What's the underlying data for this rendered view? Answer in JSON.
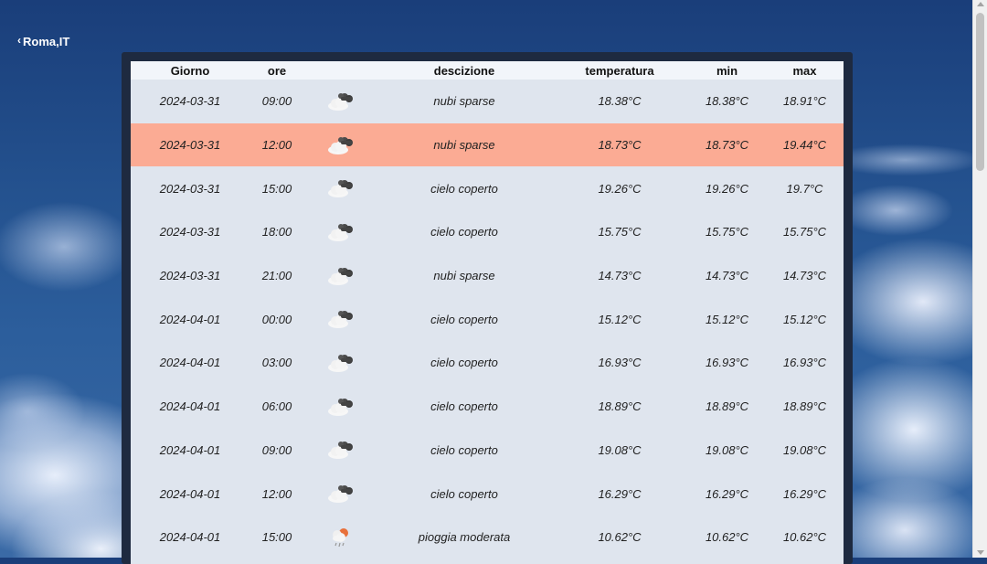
{
  "location": {
    "back_icon": "chevron-left-icon",
    "label": "Roma,IT"
  },
  "table": {
    "headers": {
      "day": "Giorno",
      "hour": "ore",
      "icon": "",
      "desc": "descizione",
      "temp": "temperatura",
      "min": "min",
      "max": "max"
    },
    "rows": [
      {
        "day": "2024-03-31",
        "hour": "09:00",
        "icon": "broken-clouds-icon",
        "desc": "nubi sparse",
        "temp": "18.38°C",
        "min": "18.38°C",
        "max": "18.91°C",
        "highlight": false
      },
      {
        "day": "2024-03-31",
        "hour": "12:00",
        "icon": "broken-clouds-icon",
        "desc": "nubi sparse",
        "temp": "18.73°C",
        "min": "18.73°C",
        "max": "19.44°C",
        "highlight": true
      },
      {
        "day": "2024-03-31",
        "hour": "15:00",
        "icon": "broken-clouds-icon",
        "desc": "cielo coperto",
        "temp": "19.26°C",
        "min": "19.26°C",
        "max": "19.7°C",
        "highlight": false
      },
      {
        "day": "2024-03-31",
        "hour": "18:00",
        "icon": "broken-clouds-icon",
        "desc": "cielo coperto",
        "temp": "15.75°C",
        "min": "15.75°C",
        "max": "15.75°C",
        "highlight": false
      },
      {
        "day": "2024-03-31",
        "hour": "21:00",
        "icon": "broken-clouds-icon",
        "desc": "nubi sparse",
        "temp": "14.73°C",
        "min": "14.73°C",
        "max": "14.73°C",
        "highlight": false
      },
      {
        "day": "2024-04-01",
        "hour": "00:00",
        "icon": "broken-clouds-icon",
        "desc": "cielo coperto",
        "temp": "15.12°C",
        "min": "15.12°C",
        "max": "15.12°C",
        "highlight": false
      },
      {
        "day": "2024-04-01",
        "hour": "03:00",
        "icon": "broken-clouds-icon",
        "desc": "cielo coperto",
        "temp": "16.93°C",
        "min": "16.93°C",
        "max": "16.93°C",
        "highlight": false
      },
      {
        "day": "2024-04-01",
        "hour": "06:00",
        "icon": "broken-clouds-icon",
        "desc": "cielo coperto",
        "temp": "18.89°C",
        "min": "18.89°C",
        "max": "18.89°C",
        "highlight": false
      },
      {
        "day": "2024-04-01",
        "hour": "09:00",
        "icon": "broken-clouds-icon",
        "desc": "cielo coperto",
        "temp": "19.08°C",
        "min": "19.08°C",
        "max": "19.08°C",
        "highlight": false
      },
      {
        "day": "2024-04-01",
        "hour": "12:00",
        "icon": "broken-clouds-icon",
        "desc": "cielo coperto",
        "temp": "16.29°C",
        "min": "16.29°C",
        "max": "16.29°C",
        "highlight": false
      },
      {
        "day": "2024-04-01",
        "hour": "15:00",
        "icon": "rain-icon",
        "desc": "pioggia moderata",
        "temp": "10.62°C",
        "min": "10.62°C",
        "max": "10.62°C",
        "highlight": false
      }
    ]
  },
  "colors": {
    "highlight_row": "#fbab94",
    "row_bg": "#dfe5ee",
    "panel_bg": "#1e2a40",
    "header_bg": "#f2f5fa"
  }
}
